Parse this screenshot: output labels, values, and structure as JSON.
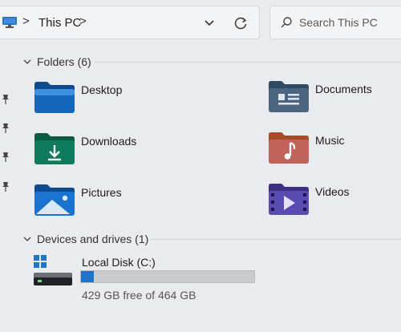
{
  "address_bar": {
    "location": "This PC",
    "separator": ">",
    "dropdown_icon": "chevron-down-icon",
    "refresh_icon": "refresh-icon"
  },
  "search": {
    "placeholder": "Search This PC"
  },
  "folders_section": {
    "title": "Folders (6)",
    "items": [
      {
        "label": "Desktop",
        "icon": "desktop-folder-icon"
      },
      {
        "label": "Documents",
        "icon": "documents-folder-icon"
      },
      {
        "label": "Downloads",
        "icon": "downloads-folder-icon"
      },
      {
        "label": "Music",
        "icon": "music-folder-icon"
      },
      {
        "label": "Pictures",
        "icon": "pictures-folder-icon"
      },
      {
        "label": "Videos",
        "icon": "videos-folder-icon"
      }
    ]
  },
  "drives_section": {
    "title": "Devices and drives (1)",
    "drives": [
      {
        "label": "Local Disk (C:)",
        "free_text": "429 GB free of 464 GB",
        "used_fraction": 0.075
      }
    ]
  },
  "colors": {
    "accent": "#1e74c9",
    "folder_blue": "#1565b8",
    "folder_green": "#0f7a5c",
    "folder_orange": "#d06a3a",
    "folder_purple": "#5a4bb0",
    "folder_slate": "#4b6580"
  }
}
